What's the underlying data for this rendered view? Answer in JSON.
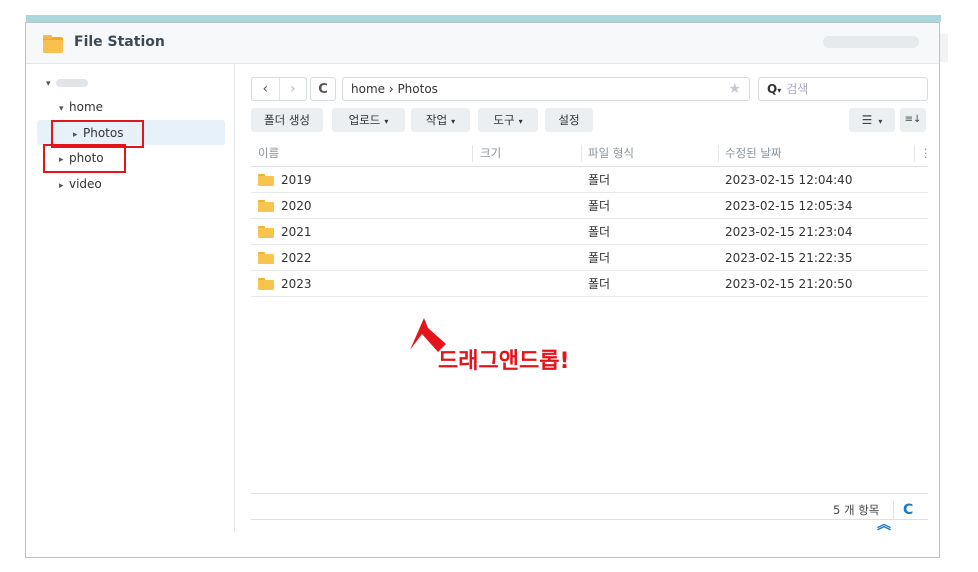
{
  "app": {
    "title": "File Station",
    "accent": "#1b7ac7",
    "annotation_color": "#e4141b"
  },
  "sidebar": {
    "root_caret": "▾",
    "items": [
      {
        "label": "home",
        "caret": "▾"
      },
      {
        "label": "Photos",
        "caret": "▸"
      },
      {
        "label": "photo",
        "caret": "▸"
      },
      {
        "label": "video",
        "caret": "▸"
      }
    ]
  },
  "nav": {
    "back": "‹",
    "forward": "›",
    "refresh": "C"
  },
  "path": {
    "text": "home › Photos",
    "star": "★"
  },
  "search": {
    "icon": "Q",
    "caret": "▾",
    "placeholder": "검색"
  },
  "toolbar": {
    "create_folder": "폴더 생성",
    "upload": "업로드",
    "action": "작업",
    "tools": "도구",
    "settings": "설정",
    "dropdown": "▾",
    "list_view": "☰",
    "sort": "≡↓"
  },
  "grid": {
    "headers": {
      "name": "이름",
      "size": "크기",
      "type": "파일 형식",
      "modified": "수정된 날짜",
      "more": "⋮"
    },
    "rows": [
      {
        "name": "2019",
        "size": "",
        "type": "폴더",
        "modified": "2023-02-15 12:04:40"
      },
      {
        "name": "2020",
        "size": "",
        "type": "폴더",
        "modified": "2023-02-15 12:05:34"
      },
      {
        "name": "2021",
        "size": "",
        "type": "폴더",
        "modified": "2023-02-15 21:23:04"
      },
      {
        "name": "2022",
        "size": "",
        "type": "폴더",
        "modified": "2023-02-15 21:22:35"
      },
      {
        "name": "2023",
        "size": "",
        "type": "폴더",
        "modified": "2023-02-15 21:20:50"
      }
    ]
  },
  "annotation": {
    "text": "드래그앤드롭!"
  },
  "footer": {
    "count": "5 개 항목",
    "refresh": "C",
    "collapse": "︽"
  }
}
